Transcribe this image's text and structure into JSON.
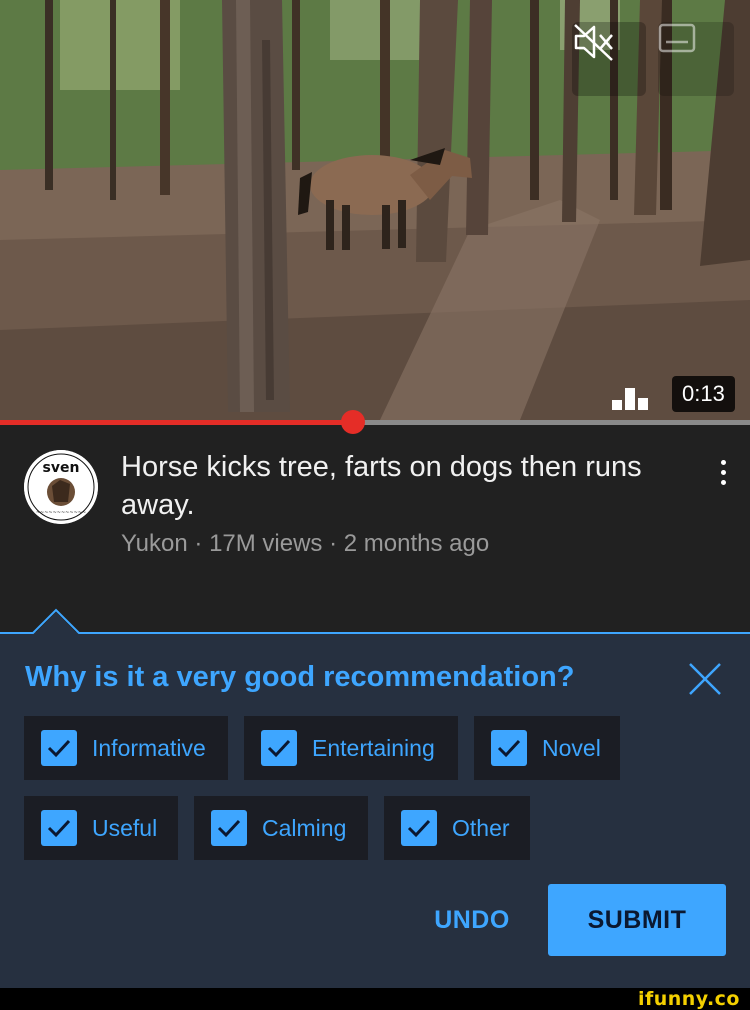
{
  "video": {
    "duration": "0:13",
    "progress_fraction": 0.47,
    "icons": {
      "mute": "volume-muted-icon",
      "captions": "captions-icon",
      "stats": "bars-icon"
    }
  },
  "video_info": {
    "title": "Horse kicks tree, farts on dogs then runs away.",
    "channel": "Yukon",
    "views": "17M views",
    "age": "2 months ago",
    "separator": " · ",
    "avatar_text": "sven"
  },
  "feedback": {
    "question": "Why is it a very good recommendation?",
    "options": [
      {
        "label": "Informative",
        "checked": true
      },
      {
        "label": "Entertaining",
        "checked": true
      },
      {
        "label": "Novel",
        "checked": true
      },
      {
        "label": "Useful",
        "checked": true
      },
      {
        "label": "Calming",
        "checked": true
      },
      {
        "label": "Other",
        "checked": true
      }
    ],
    "undo_label": "UNDO",
    "submit_label": "SUBMIT"
  },
  "watermark": "ifunny.co",
  "colors": {
    "accent": "#3ea6ff",
    "progress": "#e52d27",
    "panel": "#263040",
    "chip": "#1b1d24",
    "background": "#212121"
  }
}
